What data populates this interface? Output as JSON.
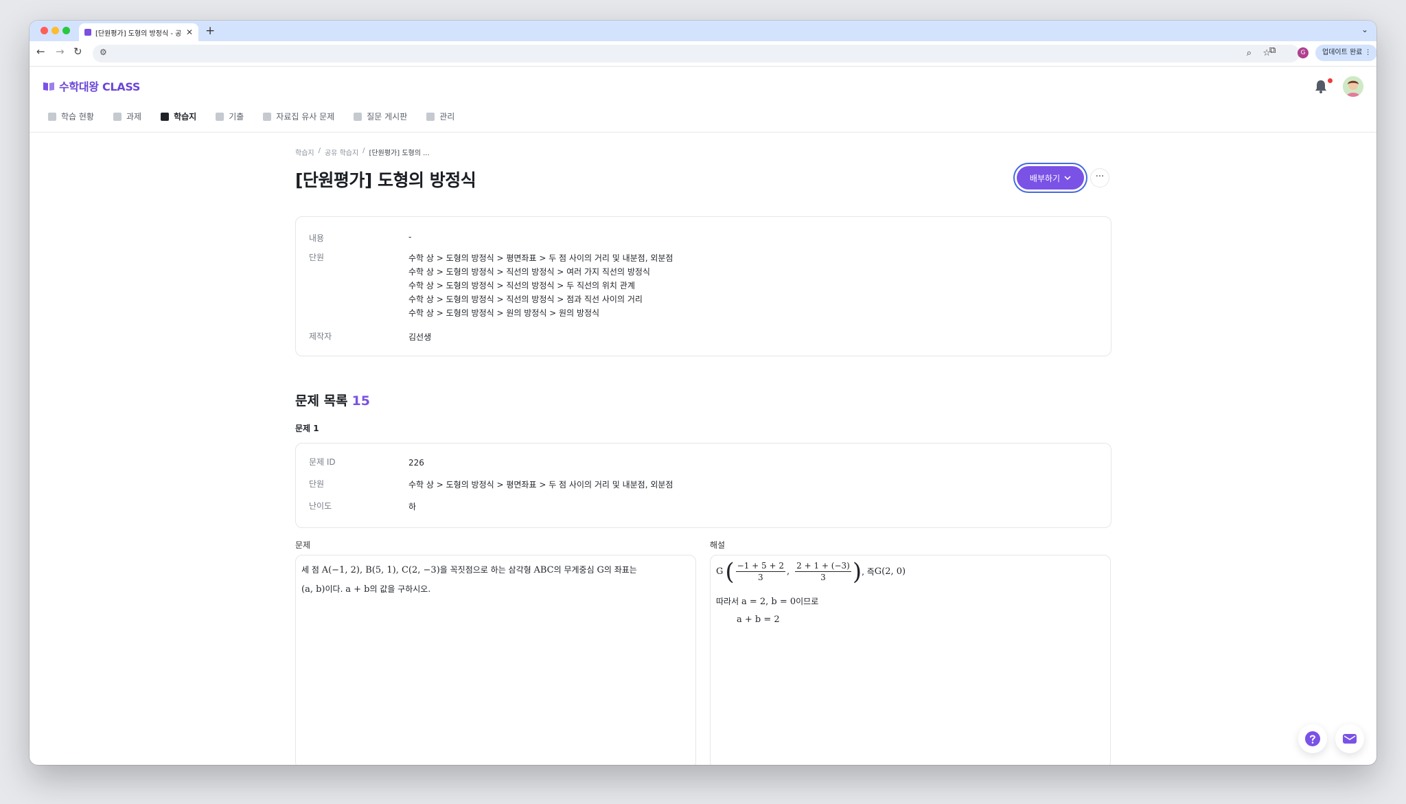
{
  "browser": {
    "tab_title": "[단원평가] 도형의 방정식 - 공유 학",
    "update_label": "업데이트 완료",
    "profile_initial": "G"
  },
  "app": {
    "logo": "수학대왕 CLASS",
    "accent_color": "#7a52e6",
    "nav": [
      {
        "label": "학습 현황",
        "icon": "graduation-cap-icon"
      },
      {
        "label": "과제",
        "icon": "document-icon"
      },
      {
        "label": "학습지",
        "icon": "worksheet-icon",
        "active": true
      },
      {
        "label": "기출",
        "icon": "layers-icon"
      },
      {
        "label": "자료집 유사 문제",
        "icon": "folder-icon"
      },
      {
        "label": "질문 게시판",
        "icon": "chat-icon"
      },
      {
        "label": "관리",
        "icon": "gear-icon"
      }
    ]
  },
  "breadcrumb": [
    "학습지",
    "공유 학습지",
    "[단원평가] 도형의 ..."
  ],
  "page": {
    "title": "[단원평가] 도형의 방정식",
    "distribute_label": "배부하기",
    "more_label": "···"
  },
  "info": {
    "content_key": "내용",
    "content_value": "-",
    "unit_key": "단원",
    "units": [
      "수학 상 > 도형의 방정식 > 평면좌표 > 두 점 사이의 거리 및 내분점, 외분점",
      "수학 상 > 도형의 방정식 > 직선의 방정식 > 여러 가지 직선의 방정식",
      "수학 상 > 도형의 방정식 > 직선의 방정식 > 두 직선의 위치 관계",
      "수학 상 > 도형의 방정식 > 직선의 방정식 > 점과 직선 사이의 거리",
      "수학 상 > 도형의 방정식 > 원의 방정식 > 원의 방정식"
    ],
    "author_key": "제작자",
    "author_value": "김선생"
  },
  "problems": {
    "title": "문제 목록",
    "count": "15",
    "first": {
      "label": "문제 1",
      "id_key": "문제 ID",
      "id_value": "226",
      "unit_key": "단원",
      "unit_value": "수학 상 > 도형의 방정식 > 평면좌표 > 두 점 사이의 거리 및 내분점, 외분점",
      "level_key": "난이도",
      "level_value": "하",
      "question_label": "문제",
      "question": {
        "t1": "세 점 ",
        "m1": "A(−1, 2), B(5, 1), C(2, −3)",
        "t2": "을 꼭짓점으로 하는 삼각형 ",
        "m2": "ABC",
        "t3": "의 무게중심 ",
        "m3": "G",
        "t4": "의 좌표는",
        "m4": "(a, b)",
        "t5": "이다. ",
        "m5": "a + b",
        "t6": "의 값을 구하시오."
      },
      "solution_label": "해설",
      "solution": {
        "g": "G",
        "f1_num": "−1 + 5 + 2",
        "f1_den": "3",
        "f2_num": "2 + 1 + (−3)",
        "f2_den": "3",
        "t1": ", 즉 ",
        "m1": "G(2, 0)",
        "t2": "따라서 ",
        "m2": "a = 2, b = 0",
        "t3": "이므로",
        "m3": "a + b = 2"
      }
    }
  }
}
